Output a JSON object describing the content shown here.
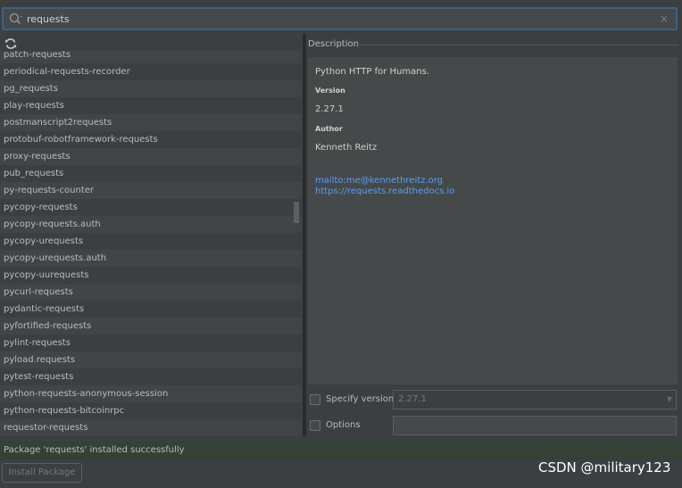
{
  "search": {
    "value": "requests",
    "clear_icon": "×"
  },
  "refresh_icon": "refresh-icon",
  "packages": [
    "patch-requests",
    "periodical-requests-recorder",
    "pg_requests",
    "play-requests",
    "postmanscript2requests",
    "protobuf-robotframework-requests",
    "proxy-requests",
    "pub_requests",
    "py-requests-counter",
    "pycopy-requests",
    "pycopy-requests.auth",
    "pycopy-urequests",
    "pycopy-urequests.auth",
    "pycopy-uurequests",
    "pycurl-requests",
    "pydantic-requests",
    "pyfortified-requests",
    "pylint-requests",
    "pyload.requests",
    "pytest-requests",
    "python-requests-anonymous-session",
    "python-requests-bitcoinrpc",
    "requestor-requests"
  ],
  "description": {
    "title": "Description",
    "summary": "Python HTTP for Humans.",
    "version_label": "Version",
    "version_value": "2.27.1",
    "author_label": "Author",
    "author_value": "Kenneth Reitz",
    "link_mail": "mailto:me@kennethreitz.org",
    "link_docs": "https://requests.readthedocs.io"
  },
  "options": {
    "specify_version_label": "Specify version",
    "specify_version_value": "2.27.1",
    "options_label": "Options"
  },
  "status": {
    "message": "Package 'requests' installed successfully"
  },
  "install_button": {
    "label": "Install Package"
  },
  "watermark": "CSDN @military123",
  "colors": {
    "background": "#3c3f41",
    "link": "#589df6",
    "status_bg": "#344134",
    "search_border": "#3d6185"
  }
}
